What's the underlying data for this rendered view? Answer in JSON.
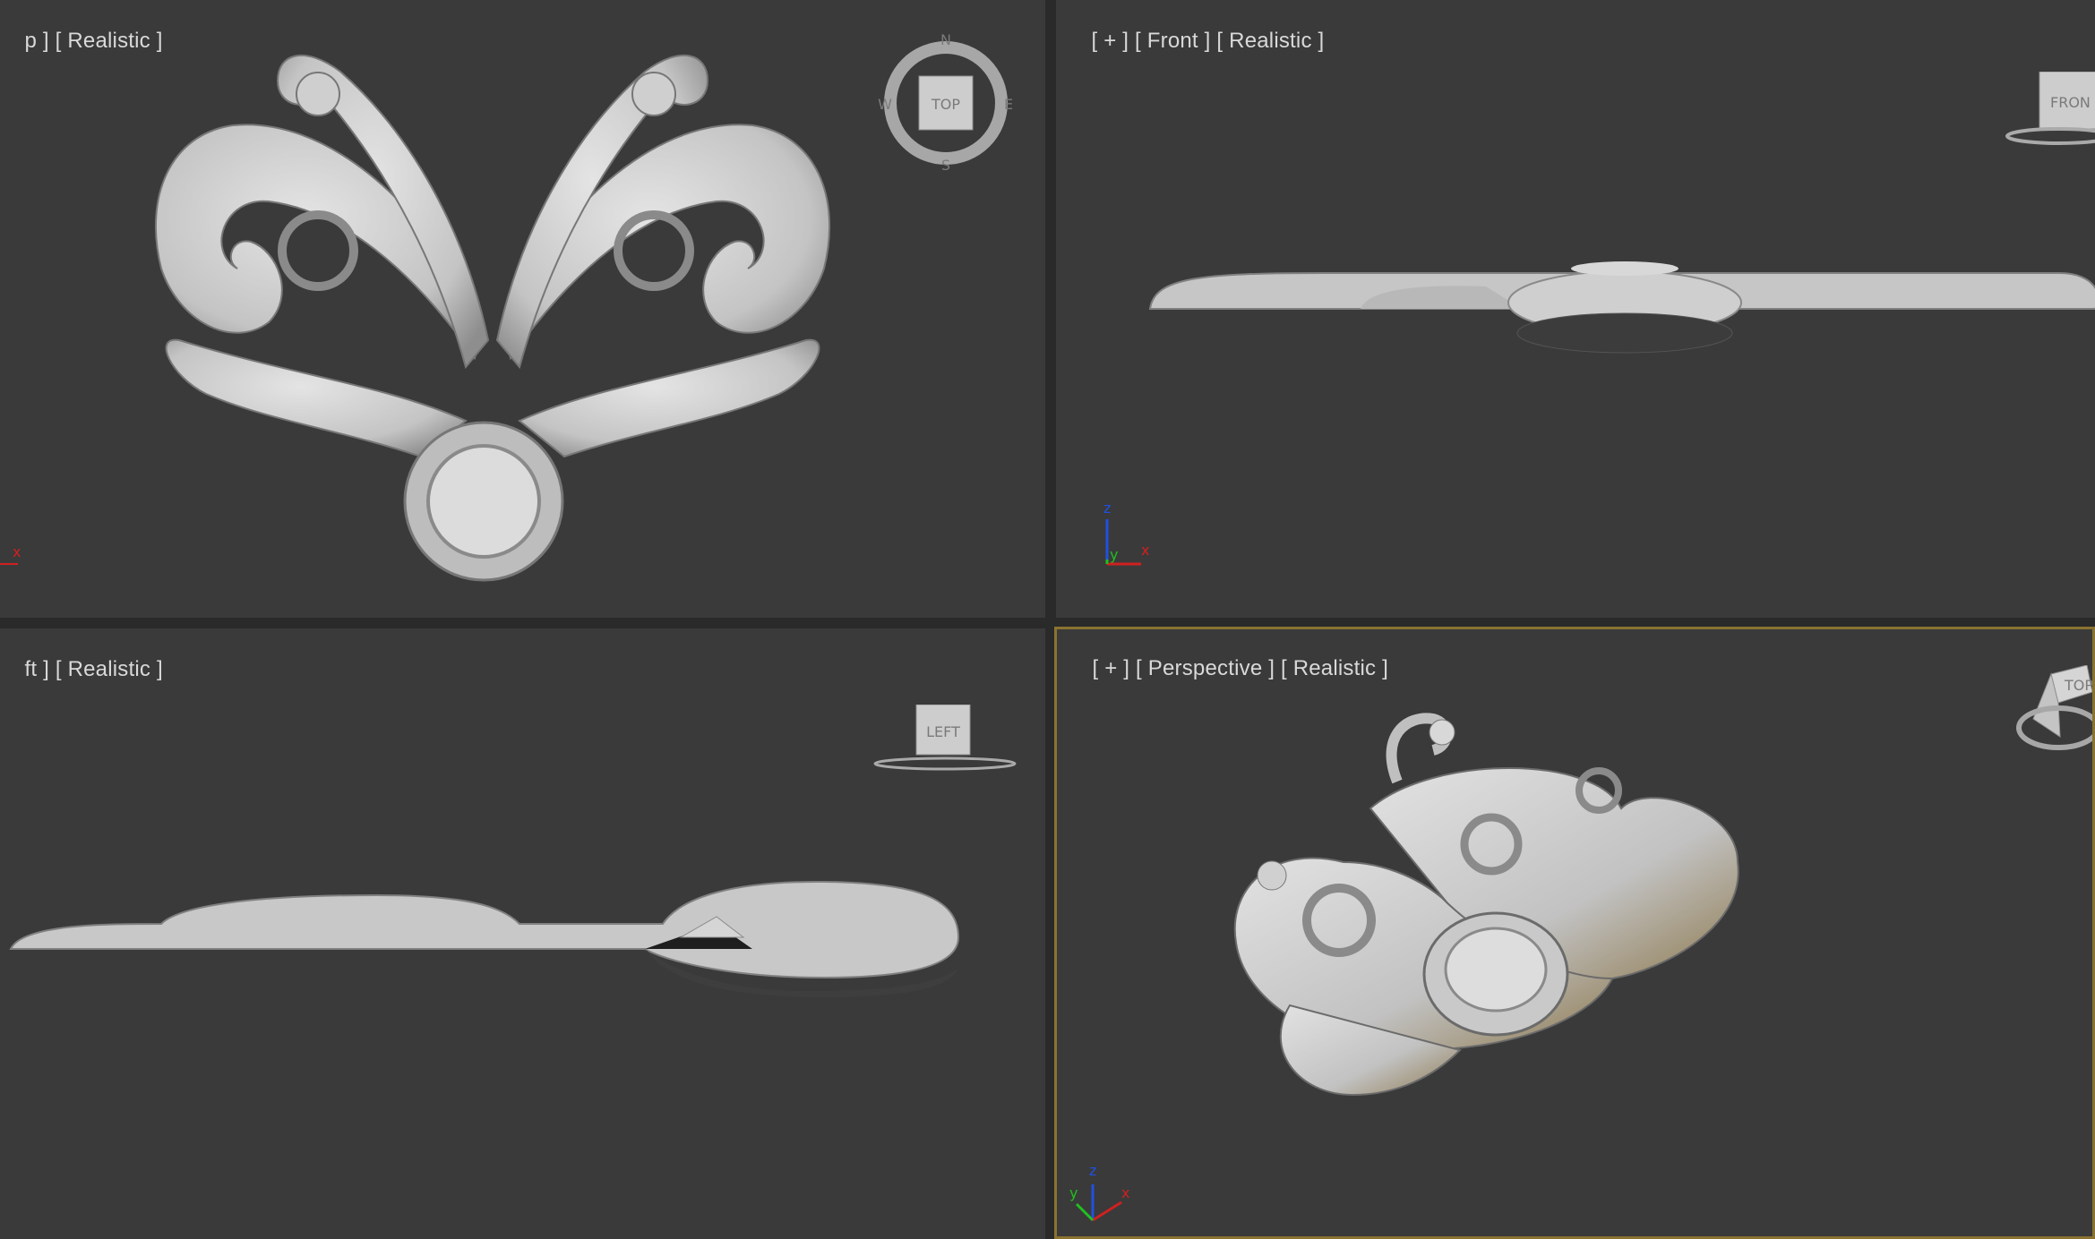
{
  "viewports": {
    "top": {
      "plus": "p ]",
      "view": "[ Realistic ]"
    },
    "front": {
      "plus": "[ + ]",
      "view": "[ Front ]",
      "shading": "[ Realistic ]"
    },
    "left": {
      "plus": "ft ]",
      "view": "[ Realistic ]"
    },
    "perspective": {
      "plus": "[ + ]",
      "view": "[ Perspective ]",
      "shading": "[ Realistic ]"
    }
  },
  "viewcube": {
    "top": "TOP",
    "front": "FRON",
    "left": "LEFT",
    "persp_top": "TOP",
    "compass": {
      "n": "N",
      "s": "S",
      "e": "E",
      "w": "W"
    }
  },
  "axes": {
    "x": "x",
    "y": "y",
    "z": "z"
  },
  "colors": {
    "viewport_bg": "#3a3a3a",
    "active_border": "#8a7330",
    "model": "#c8c8c8",
    "axis_x": "#d02020",
    "axis_y": "#20c020",
    "axis_z": "#2050e0"
  }
}
